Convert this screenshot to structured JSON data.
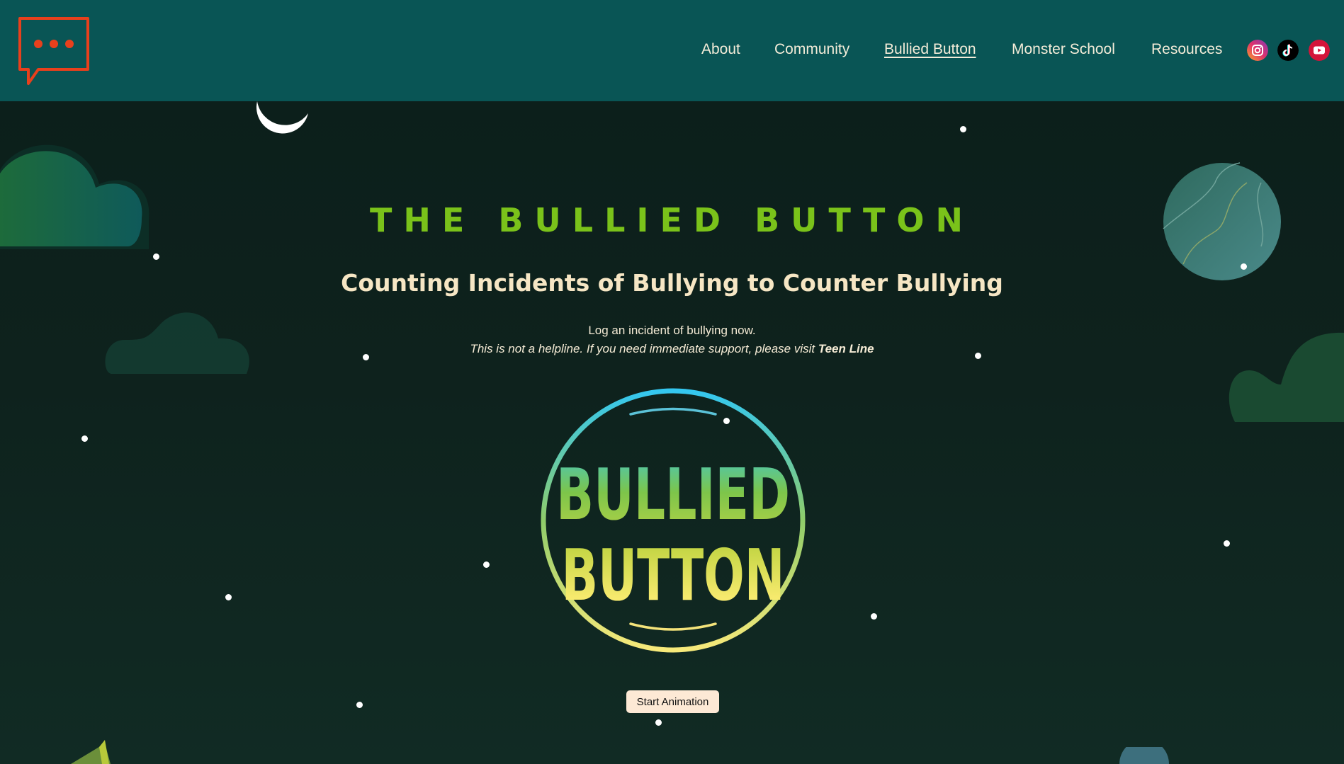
{
  "nav": {
    "links": [
      {
        "label": "About"
      },
      {
        "label": "Community"
      },
      {
        "label": "Bullied Button"
      },
      {
        "label": "Monster School"
      },
      {
        "label": "Resources"
      }
    ],
    "active": "Bullied Button",
    "social": [
      "instagram-icon",
      "tiktok-icon",
      "youtube-icon"
    ]
  },
  "hero": {
    "title": "THE BULLIED BUTTON",
    "subtitle": "Counting Incidents of Bullying to Counter Bullying",
    "cta_text": "Log an incident of bullying now.",
    "disclaimer": "This is not a helpline. If you need immediate support, please visit ",
    "helpline_link": "Teen Line"
  },
  "badge": {
    "line1": "BULLIED",
    "line2": "BUTTON"
  },
  "button": {
    "start": "Start Animation"
  },
  "colors": {
    "header": "#095555",
    "title_green": "#7ac21a",
    "cream": "#f6e6c4",
    "logo_red": "#e8401c"
  }
}
